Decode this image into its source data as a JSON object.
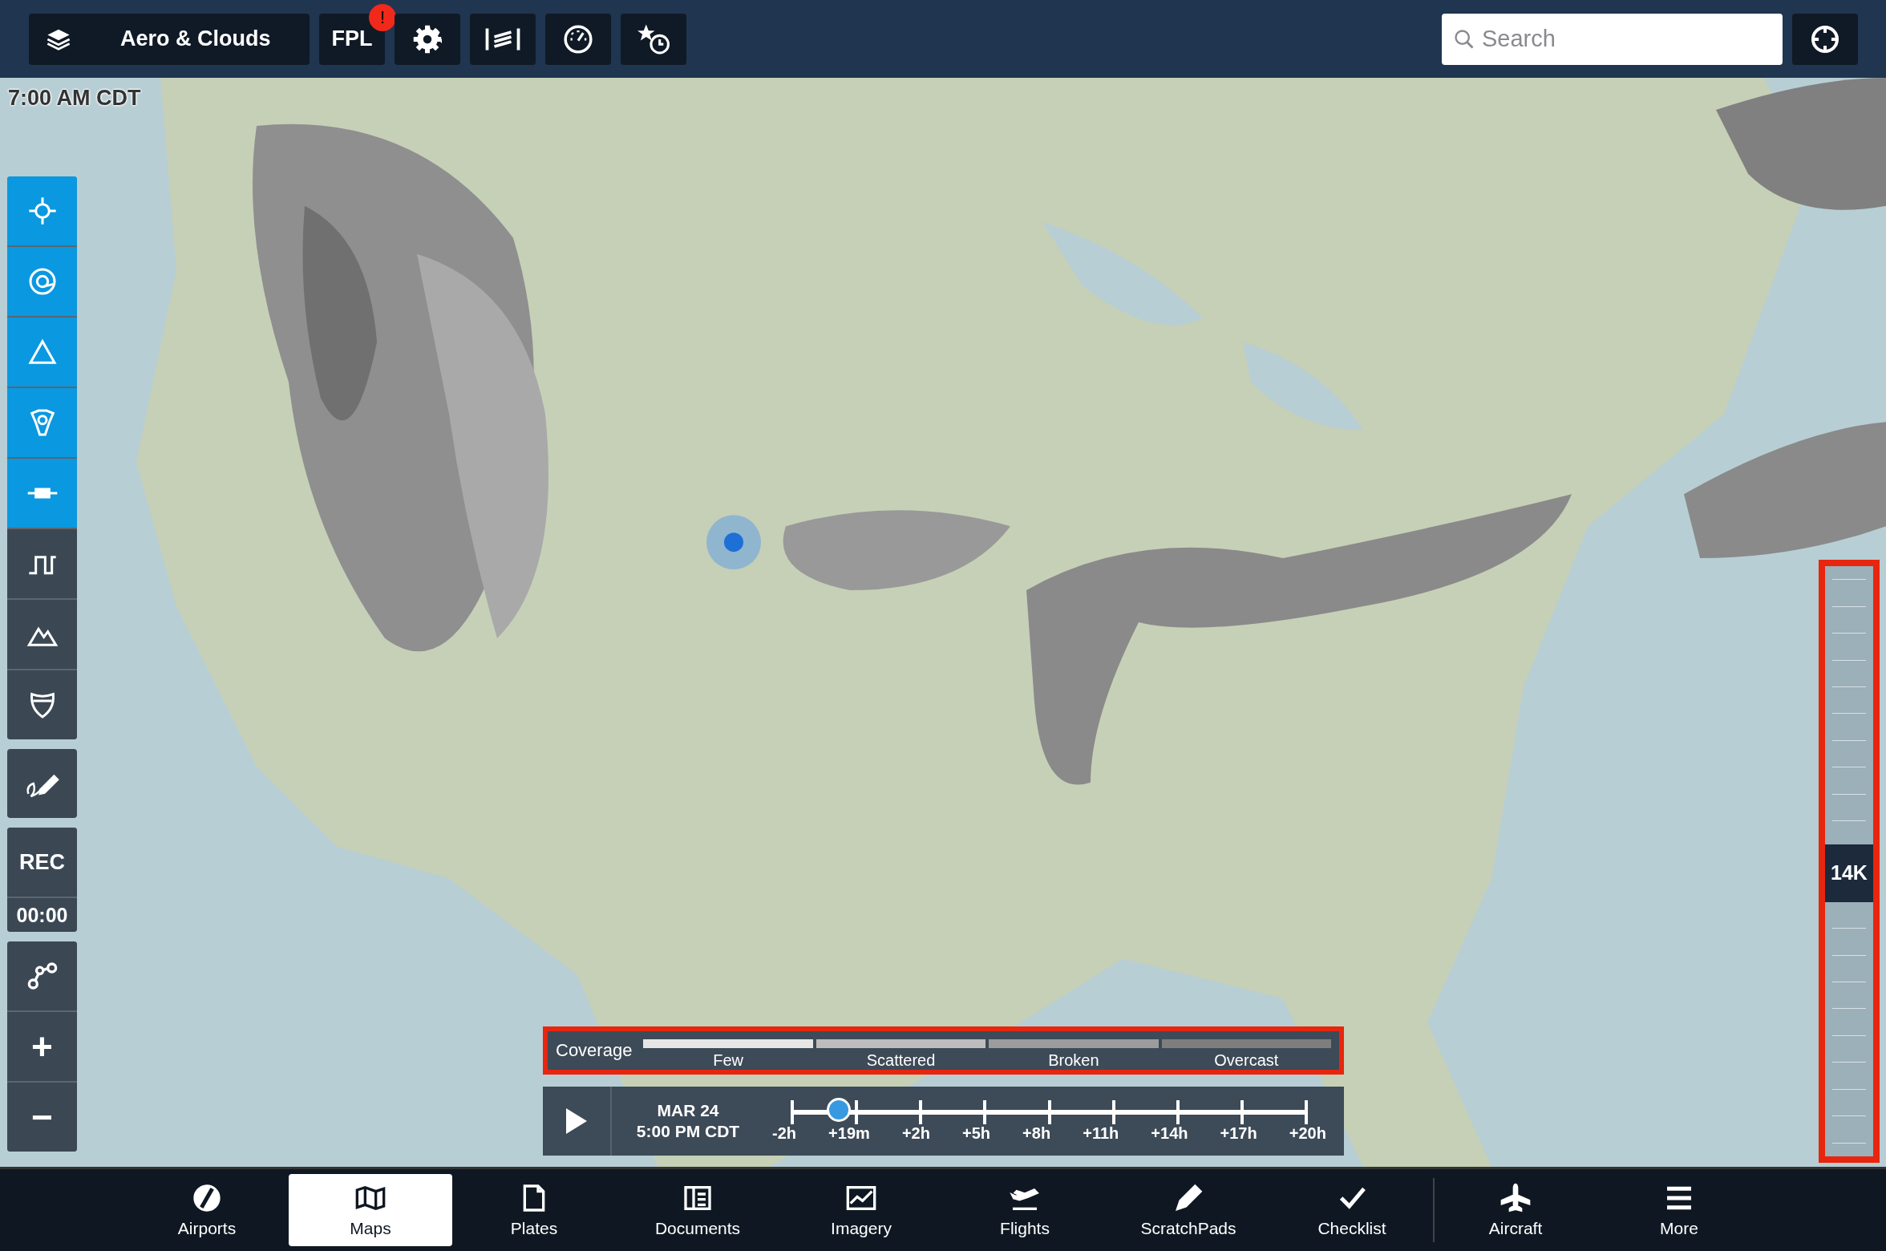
{
  "top_bar": {
    "layers_button": {
      "label": "Aero & Clouds"
    },
    "fpl_button": {
      "label": "FPL",
      "badge": "!"
    },
    "search": {
      "placeholder": "Search"
    }
  },
  "map": {
    "kind": "picture",
    "time": "7:00 AM CDT"
  },
  "map_tools": [
    {
      "kind": "waypoint",
      "on": true
    },
    {
      "kind": "target",
      "on": true
    },
    {
      "kind": "triangle",
      "on": true
    },
    {
      "kind": "fix",
      "on": true
    },
    {
      "kind": "runway",
      "on": true
    },
    {
      "kind": "step",
      "on": false
    },
    {
      "kind": "mountain",
      "on": false
    },
    {
      "kind": "highway",
      "on": false
    }
  ],
  "record": {
    "label": "REC",
    "timer": "00:00"
  },
  "zoom_buttons": [
    "+",
    "−"
  ],
  "coverage_legend": {
    "title": "Coverage",
    "highlighted": true,
    "items": [
      {
        "label": "Few",
        "color": "#e6e6e6"
      },
      {
        "label": "Scattered",
        "color": "#bdbdbd"
      },
      {
        "label": "Broken",
        "color": "#9c9c9c"
      },
      {
        "label": "Overcast",
        "color": "#7e7e7e"
      }
    ]
  },
  "timeline": {
    "date": "MAR 24",
    "time": "5:00 PM CDT",
    "level": 0.09,
    "ticks": [
      "-2h",
      "+19m",
      "+2h",
      "+5h",
      "+8h",
      "+11h",
      "+14h",
      "+17h",
      "+20h"
    ]
  },
  "altitude_slider": {
    "label": "14K",
    "level": 0.48,
    "highlighted": true
  },
  "tabs": [
    {
      "kind": "airports",
      "label": "Airports",
      "selected": false
    },
    {
      "kind": "maps",
      "label": "Maps",
      "selected": true
    },
    {
      "kind": "plates",
      "label": "Plates",
      "selected": false
    },
    {
      "kind": "documents",
      "label": "Documents",
      "selected": false
    },
    {
      "kind": "imagery",
      "label": "Imagery",
      "selected": false
    },
    {
      "kind": "flights",
      "label": "Flights",
      "selected": false
    },
    {
      "kind": "scratchpads",
      "label": "ScratchPads",
      "selected": false
    },
    {
      "kind": "checklist",
      "label": "Checklist",
      "selected": false
    },
    {
      "kind": "aircraft",
      "label": "Aircraft",
      "selected": false
    },
    {
      "kind": "more",
      "label": "More",
      "selected": false
    }
  ]
}
